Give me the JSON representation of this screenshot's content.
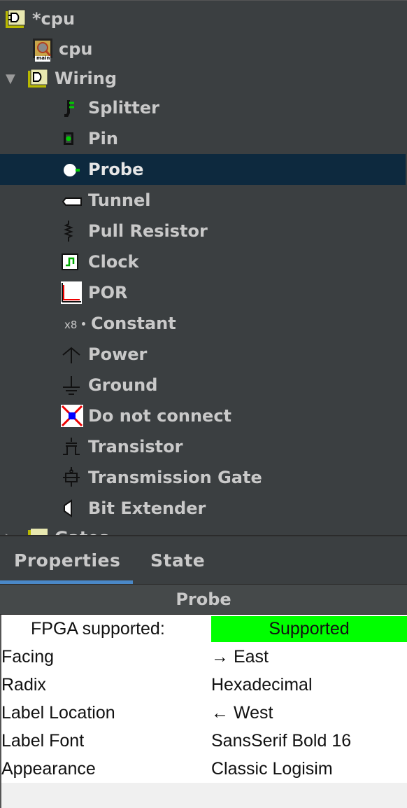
{
  "tree": {
    "root_label": "*cpu",
    "cpu_label": "cpu",
    "cpu_icon_caption": "main",
    "wiring_label": "Wiring",
    "items": [
      {
        "label": "Splitter",
        "icon": "splitter-icon"
      },
      {
        "label": "Pin",
        "icon": "pin-icon"
      },
      {
        "label": "Probe",
        "icon": "probe-icon"
      },
      {
        "label": "Tunnel",
        "icon": "tunnel-icon"
      },
      {
        "label": "Pull Resistor",
        "icon": "pull-resistor-icon"
      },
      {
        "label": "Clock",
        "icon": "clock-icon"
      },
      {
        "label": "POR",
        "icon": "por-icon"
      },
      {
        "label": "Constant",
        "icon": "constant-icon"
      },
      {
        "label": "Power",
        "icon": "power-icon"
      },
      {
        "label": "Ground",
        "icon": "ground-icon"
      },
      {
        "label": "Do not connect",
        "icon": "do-not-connect-icon"
      },
      {
        "label": "Transistor",
        "icon": "transistor-icon"
      },
      {
        "label": "Transmission Gate",
        "icon": "transmission-gate-icon"
      },
      {
        "label": "Bit Extender",
        "icon": "bit-extender-icon"
      }
    ],
    "gates_label": "Gates",
    "constant_icon_text": "x8"
  },
  "tabs": {
    "properties": "Properties",
    "state": "State"
  },
  "properties": {
    "title": "Probe",
    "fpga_label": "FPGA supported:",
    "fpga_value": "Supported",
    "rows": [
      {
        "key": "Facing",
        "value": "→ East"
      },
      {
        "key": "Radix",
        "value": "Hexadecimal"
      },
      {
        "key": "Label Location",
        "value": "← West"
      },
      {
        "key": "Label Font",
        "value": "SansSerif Bold 16"
      },
      {
        "key": "Appearance",
        "value": "Classic Logisim"
      }
    ]
  },
  "colors": {
    "tree_bg": "#3b3f41",
    "selected_bg": "#0d293e",
    "supported_green": "#00ff00",
    "tab_underline": "#4a88c7"
  }
}
